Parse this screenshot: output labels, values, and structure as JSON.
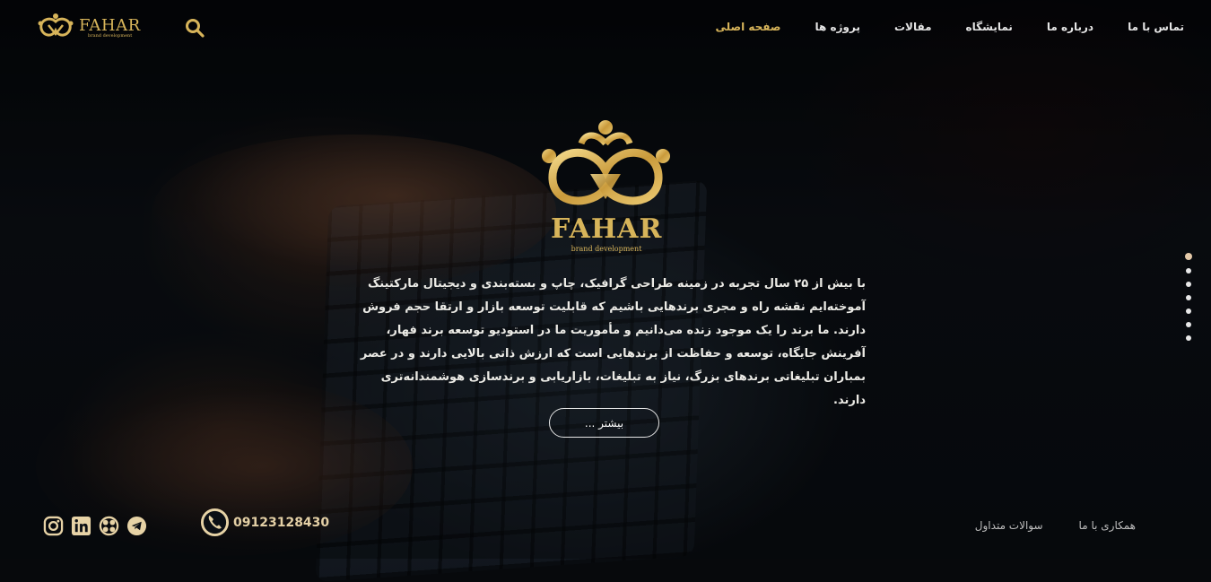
{
  "brand": {
    "name": "FAHAR",
    "tagline": "brand development",
    "gold": "#d7b45a"
  },
  "header": {
    "nav": [
      {
        "label": "صفحه اصلی",
        "active": true
      },
      {
        "label": "پروژه ها"
      },
      {
        "label": "مقالات"
      },
      {
        "label": "نمایشگاه"
      },
      {
        "label": "درباره ما"
      },
      {
        "label": "تماس با ما"
      }
    ],
    "search_icon": "search-icon"
  },
  "hero": {
    "description": "با بیش از ۲۵ سال تجربه در زمینه طراحی گرافیک، چاپ و بسته‌بندی و دیجیتال مارکتینگ آموخته‌ایم نقشه راه و مجری برندهایی باشیم که قابلیت توسعه بازار و ارتقا حجم فروش دارند. ما برند را یک موجود زنده می‌دانیم و مأموریت ما در استودیو توسعه برند فهار، آفرینش جایگاه، توسعه و حفاظت از برندهایی است که ارزش ذاتی بالایی دارند و در عصر بمباران تبلیغاتی برندهای بزرگ، نیاز به تبلیغات، بازاریابی و برندسازی هوشمندانه‌تری دارند.",
    "more_button": "بیشتر ..."
  },
  "pagination": {
    "count": 7,
    "active_index": 0
  },
  "footer": {
    "phone": "09123128430",
    "links": [
      "همکاری با ما",
      "سوالات متداول"
    ],
    "socials": [
      "instagram-icon",
      "linkedin-icon",
      "aparat-icon",
      "telegram-icon"
    ]
  }
}
